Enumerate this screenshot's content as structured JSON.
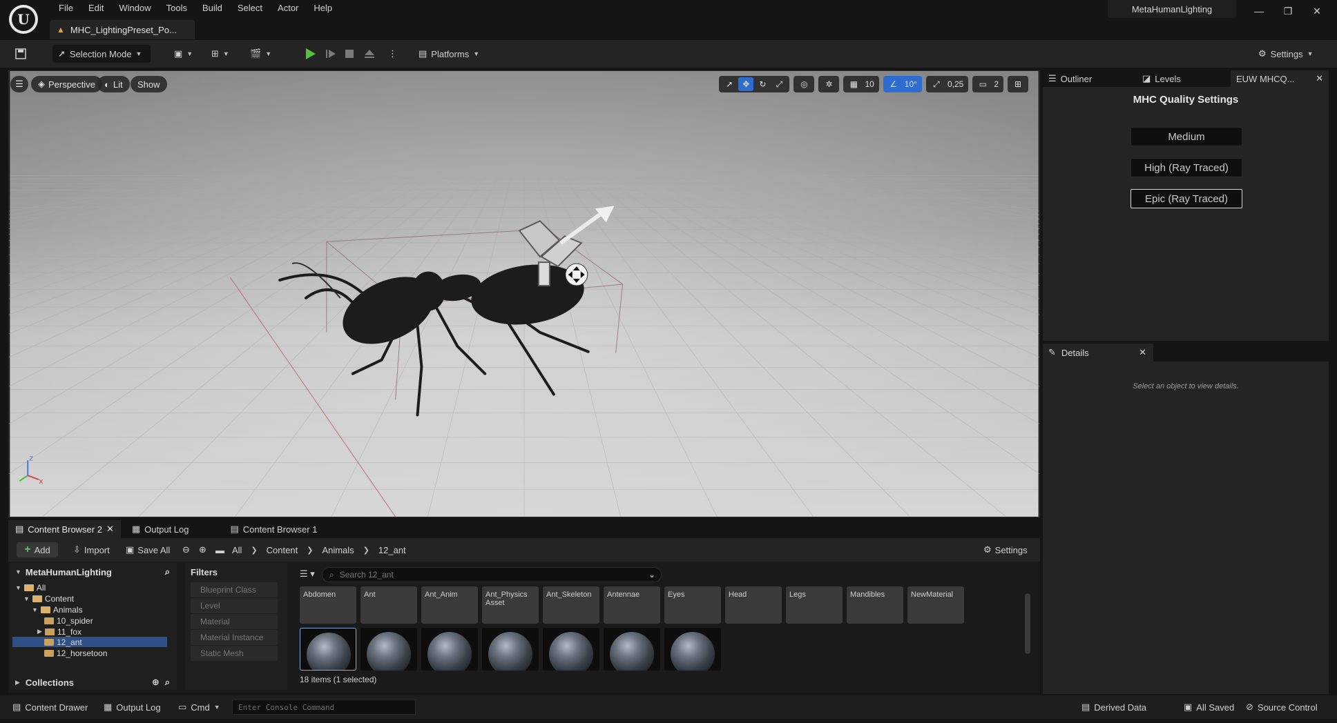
{
  "window": {
    "project_name": "MetaHumanLighting",
    "document_tab": "MHC_LightingPreset_Po...",
    "menus": [
      "File",
      "Edit",
      "Window",
      "Tools",
      "Build",
      "Select",
      "Actor",
      "Help"
    ]
  },
  "toolbar": {
    "selection_mode": "Selection Mode",
    "platforms": "Platforms",
    "settings": "Settings"
  },
  "viewport": {
    "perspective": "Perspective",
    "lit": "Lit",
    "show": "Show",
    "grid_snap": "10",
    "rotation_snap": "10°",
    "scale_snap": "0,25",
    "camera_speed": "2"
  },
  "right_panel": {
    "tabs": [
      "Outliner",
      "Levels",
      "EUW MHCQ..."
    ],
    "title": "MHC Quality Settings",
    "buttons": [
      "Medium",
      "High (Ray Traced)",
      "Epic (Ray Traced)"
    ]
  },
  "details": {
    "tab": "Details",
    "empty_text": "Select an object to view details."
  },
  "content_browser": {
    "tabs": [
      "Content Browser 2",
      "Output Log",
      "Content Browser 1"
    ],
    "add": "Add",
    "import": "Import",
    "save_all": "Save All",
    "breadcrumb": [
      "All",
      "Content",
      "Animals",
      "12_ant"
    ],
    "settings": "Settings",
    "tree_root": "MetaHumanLighting",
    "tree": [
      "All",
      "Content",
      "Animals",
      "10_spider",
      "11_fox",
      "12_ant",
      "12_horsetoon"
    ],
    "collections": "Collections",
    "filters_title": "Filters",
    "filters": [
      "Blueprint Class",
      "Level",
      "Material",
      "Material Instance",
      "Static Mesh"
    ],
    "search_placeholder": "Search 12_ant",
    "folders": [
      "Abdomen",
      "Ant",
      "Ant_Anim",
      "Ant_Physics Asset",
      "Ant_Skeleton",
      "Antennae",
      "Eyes",
      "Head",
      "Legs",
      "Mandibles",
      "NewMaterial"
    ],
    "items_count": "18 items (1 selected)"
  },
  "statusbar": {
    "content_drawer": "Content Drawer",
    "output_log": "Output Log",
    "cmd": "Cmd",
    "console_placeholder": "Enter Console Command",
    "derived_data": "Derived Data",
    "all_saved": "All Saved",
    "source_control": "Source Control"
  }
}
